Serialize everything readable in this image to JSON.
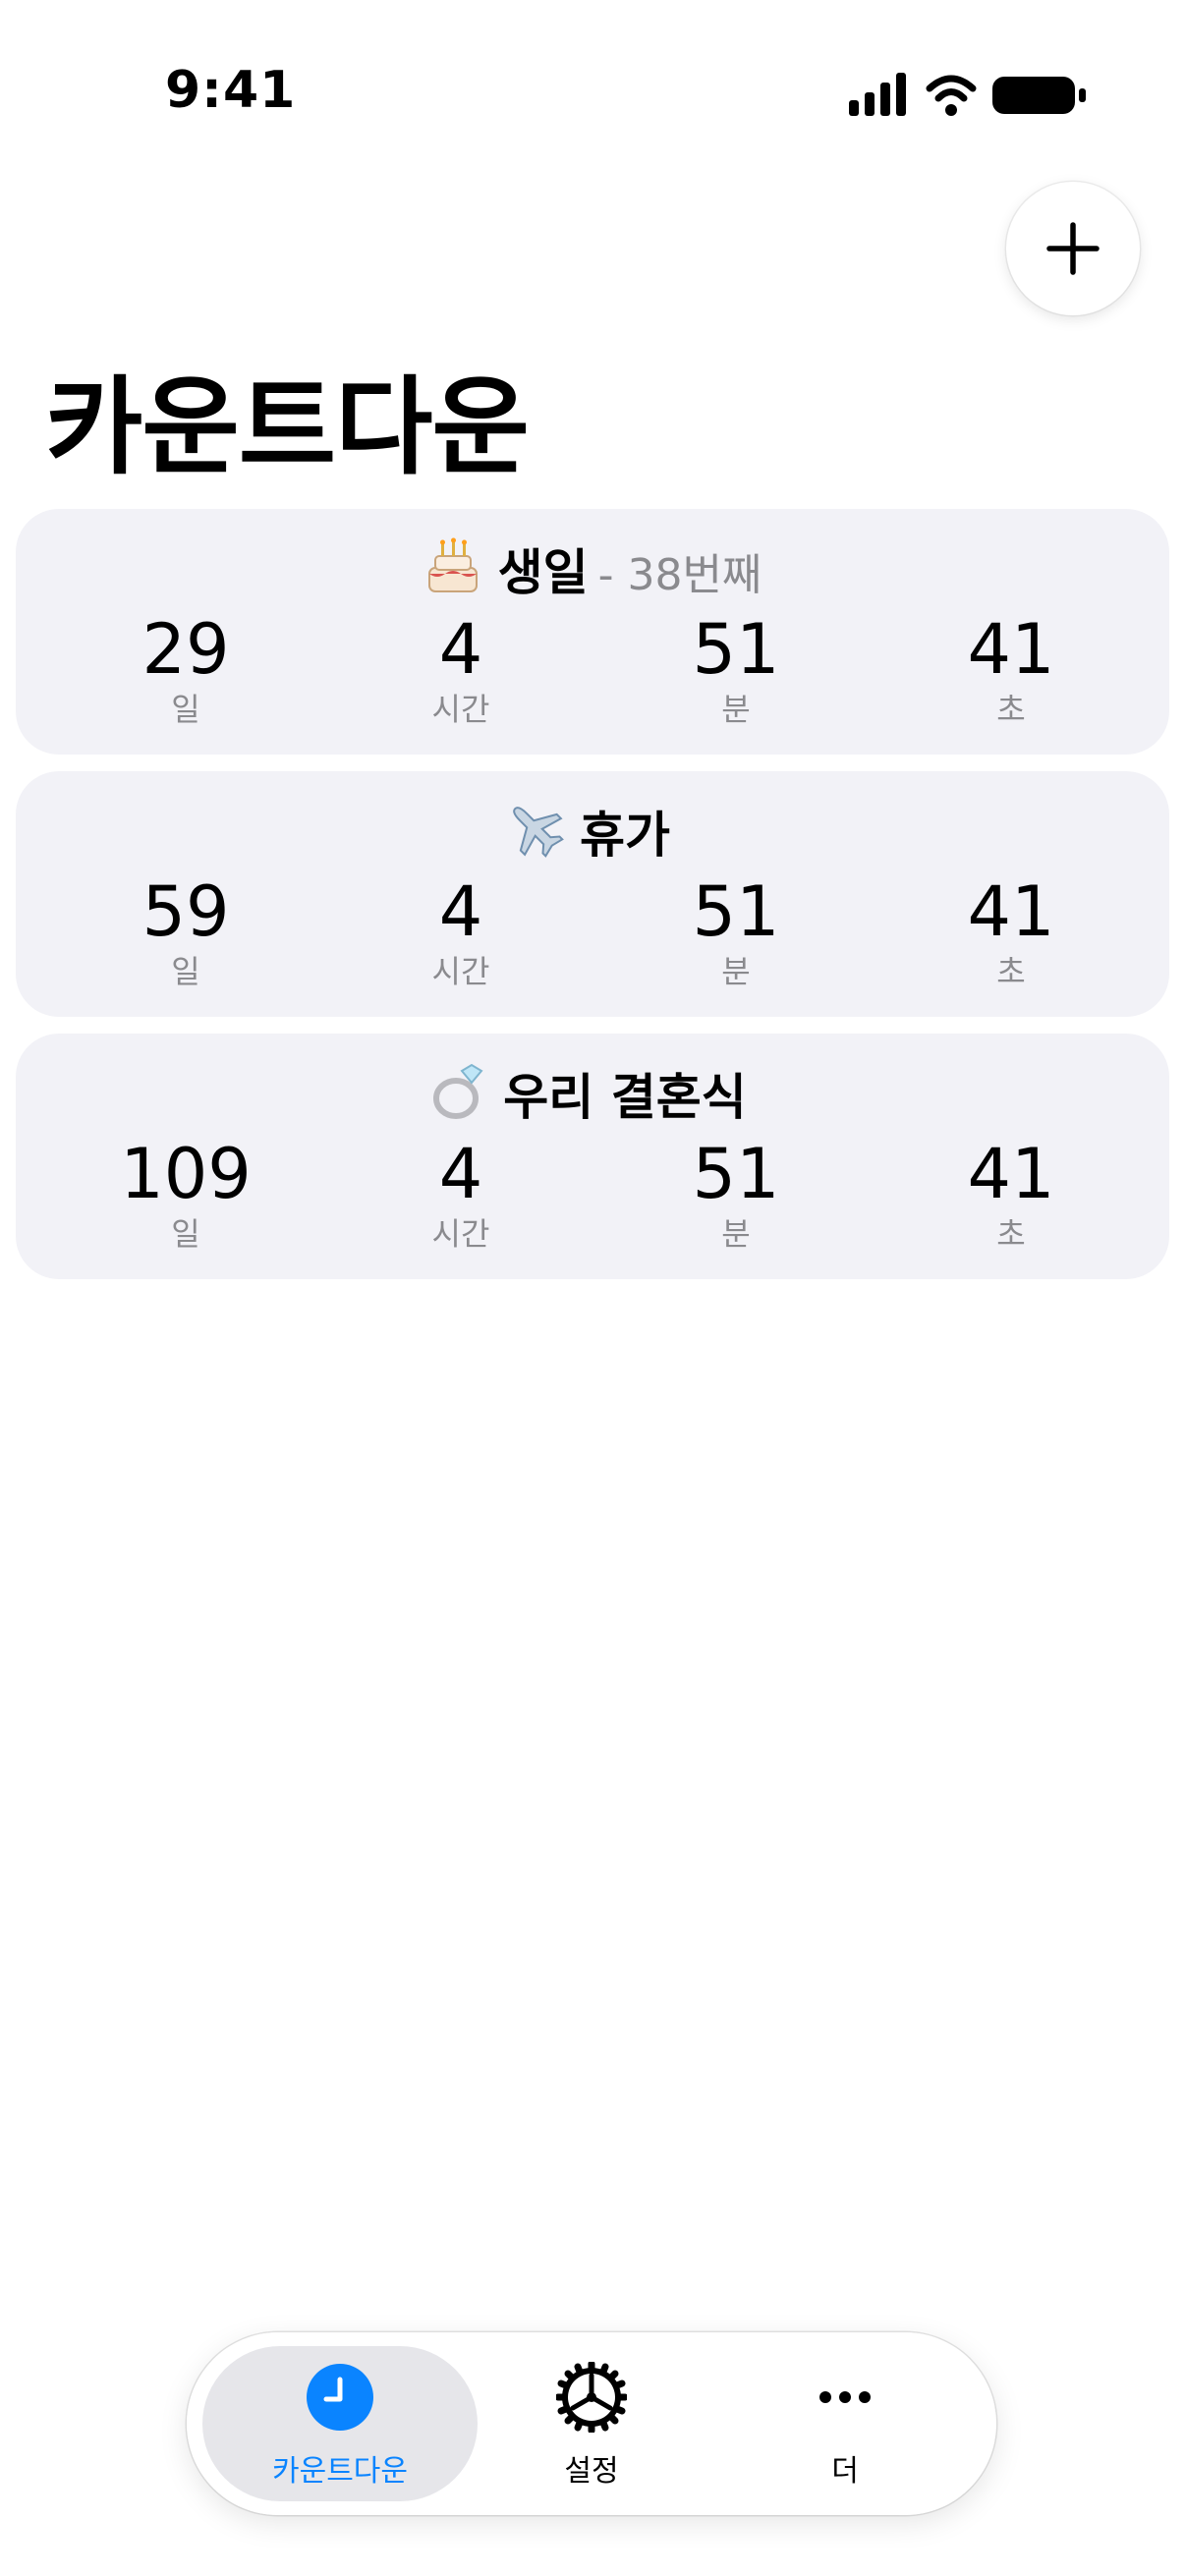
{
  "status_bar": {
    "time": "9:41"
  },
  "header": {
    "title": "카운트다운",
    "add_button_icon": "plus-icon"
  },
  "countdowns": [
    {
      "emoji": "🎂",
      "title": "생일",
      "suffix": "- 38번째",
      "days": "29",
      "hours": "4",
      "minutes": "51",
      "seconds": "41"
    },
    {
      "emoji": "✈️",
      "title": "휴가",
      "suffix": "",
      "days": "59",
      "hours": "4",
      "minutes": "51",
      "seconds": "41"
    },
    {
      "emoji": "💍",
      "title": "우리 결혼식",
      "suffix": "",
      "days": "109",
      "hours": "4",
      "minutes": "51",
      "seconds": "41"
    }
  ],
  "units": {
    "days": "일",
    "hours": "시간",
    "minutes": "분",
    "seconds": "초"
  },
  "tabs": [
    {
      "label": "카운트다운",
      "icon": "clock-icon",
      "active": true
    },
    {
      "label": "설정",
      "icon": "gear-icon",
      "active": false
    },
    {
      "label": "더",
      "icon": "ellipsis-icon",
      "active": false
    }
  ],
  "colors": {
    "accent": "#0a84ff",
    "card_bg": "#f2f2f7",
    "secondary_text": "#8a8a8e"
  }
}
